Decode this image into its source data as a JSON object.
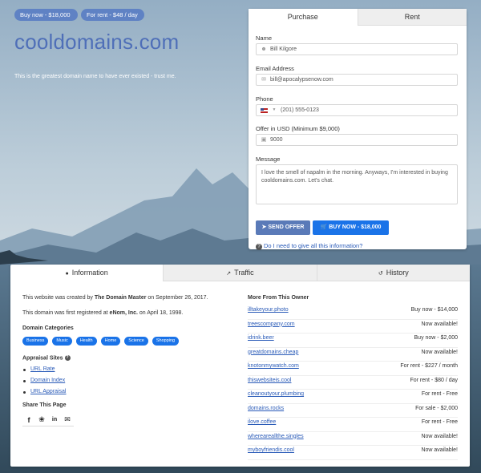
{
  "header": {
    "buy_pill": "Buy now - $18,000",
    "rent_pill": "For rent - $48 / day",
    "domain": "cooldomains.com",
    "tagline": "This is the greatest domain name to have ever existed - trust me."
  },
  "form": {
    "tabs": [
      "Purchase",
      "Rent"
    ],
    "name_label": "Name",
    "name_value": "Bill Kilgore",
    "email_label": "Email Address",
    "email_value": "bill@apocalypsenow.com",
    "phone_label": "Phone",
    "phone_value": "(201) 555-0123",
    "offer_label": "Offer in USD (Minimum $9,000)",
    "offer_value": "9000",
    "message_label": "Message",
    "message_value": "I love the smell of napalm in the morning. Anyways, I'm interested in buying cooldomains.com. Let's chat.",
    "send_button": "SEND OFFER",
    "buy_button": "BUY NOW - $18,000",
    "help_link": "Do I need to give all this information?"
  },
  "info": {
    "tabs": [
      "Information",
      "Traffic",
      "History"
    ],
    "created_prefix": "This website was created by ",
    "created_by": "The Domain Master",
    "created_suffix": " on September 26, 2017.",
    "registered_prefix": "This domain was first registered at ",
    "registrar": "eNom, Inc.",
    "registered_suffix": " on April 18, 1998.",
    "categories_title": "Domain Categories",
    "categories": [
      "Business",
      "Music",
      "Health",
      "Home",
      "Science",
      "Shopping"
    ],
    "appraisal_title": "Appraisal Sites",
    "appraisal_sites": [
      "URL Rate",
      "Domain Index",
      "URL Appraisal"
    ],
    "share_title": "Share This Page",
    "more_title": "More From This Owner",
    "owner_domains": [
      {
        "domain": "illtakeyour.photo",
        "status": "Buy now - $14,000"
      },
      {
        "domain": "treescompany.com",
        "status": "Now available!"
      },
      {
        "domain": "idrink.beer",
        "status": "Buy now - $2,000"
      },
      {
        "domain": "greatdomains.cheap",
        "status": "Now available!"
      },
      {
        "domain": "knotonmywatch.com",
        "status": "For rent - $227 / month"
      },
      {
        "domain": "thiswebsiteis.cool",
        "status": "For rent - $80 / day"
      },
      {
        "domain": "cleanoutyour.plumbing",
        "status": "For rent - Free"
      },
      {
        "domain": "domains.rocks",
        "status": "For sale - $2,000"
      },
      {
        "domain": "ilove.coffee",
        "status": "For rent - Free"
      },
      {
        "domain": "whereareallthe.singles",
        "status": "Now available!"
      },
      {
        "domain": "myboyfriendis.cool",
        "status": "Now available!"
      }
    ]
  },
  "colors": {
    "pill": "#5f82c4",
    "title": "#4f6fb8",
    "primary_button": "#1a73e8",
    "send_button": "#5a7ab8",
    "link": "#2a5bb8"
  }
}
